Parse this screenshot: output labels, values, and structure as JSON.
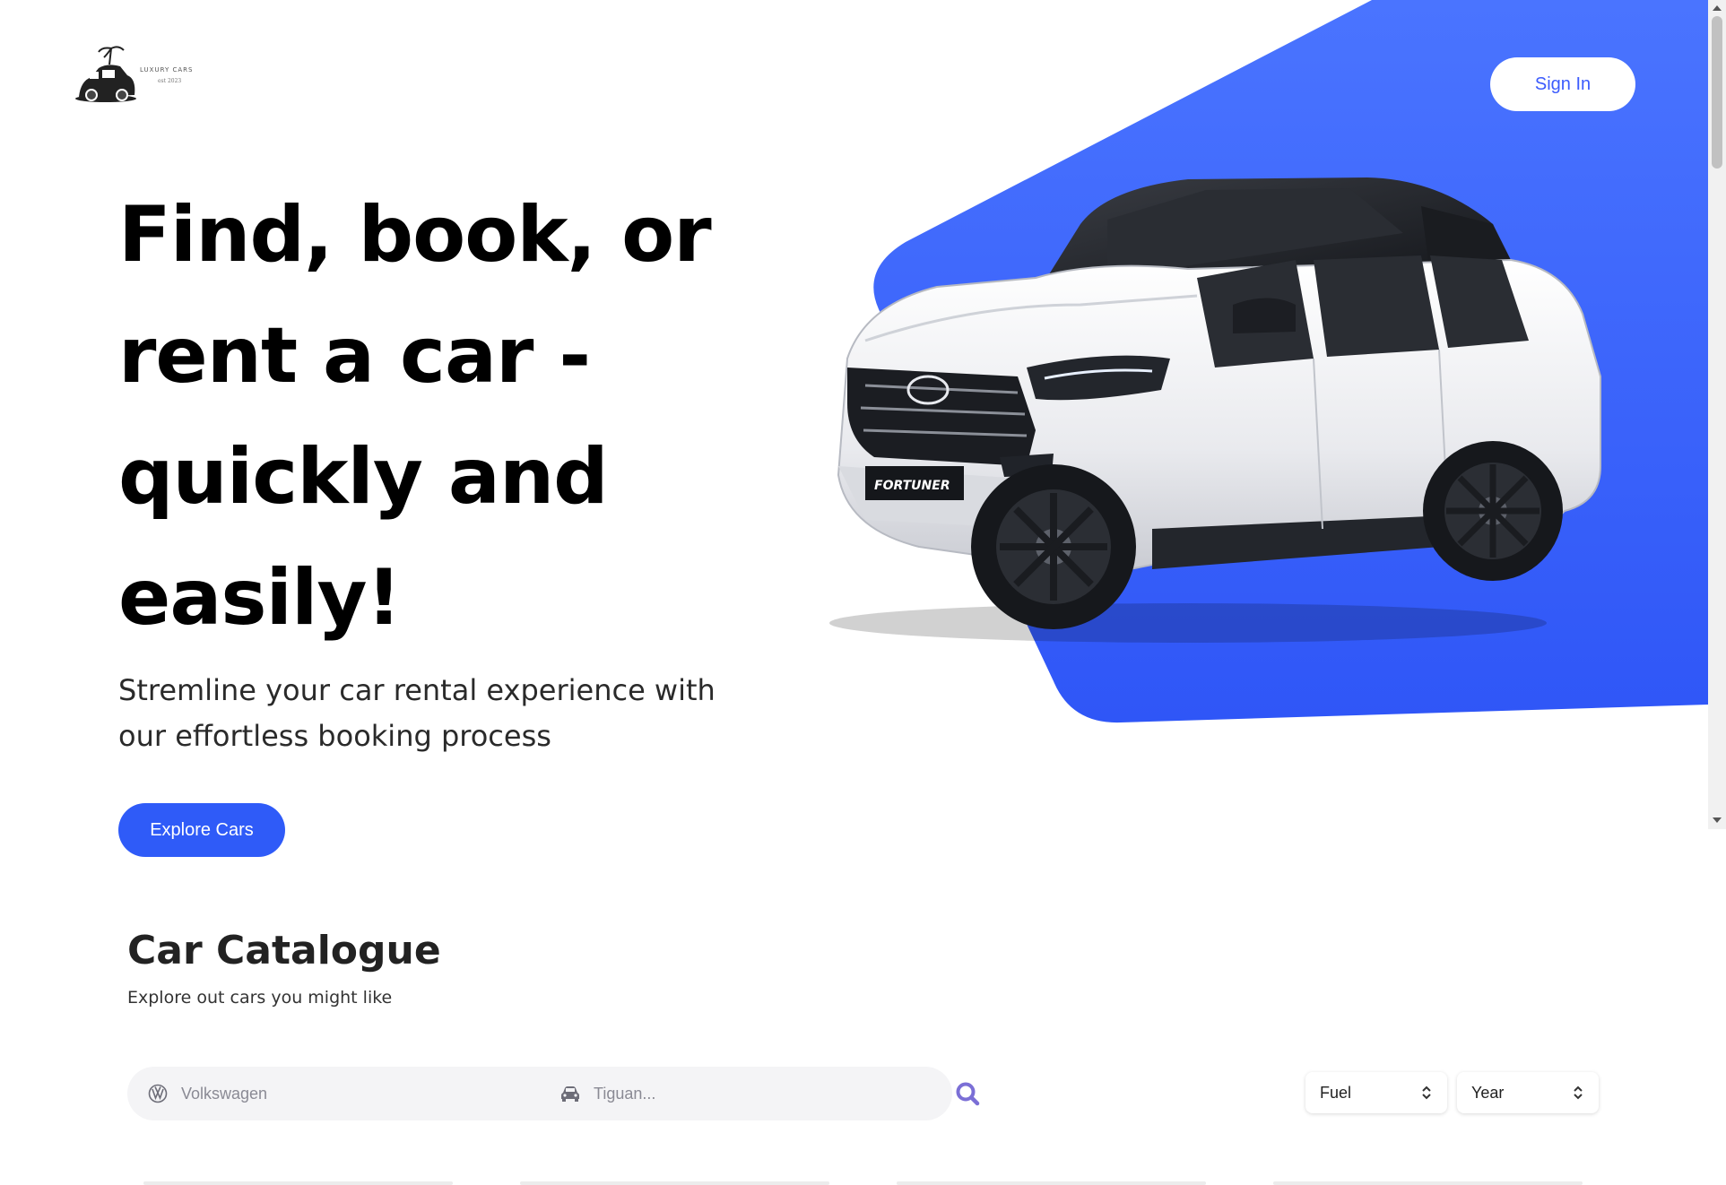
{
  "header": {
    "logo_alt": "Car rental logo",
    "sign_in_label": "Sign In"
  },
  "hero": {
    "headline_line1": "Find, book, or",
    "headline_line2": "rent a car -",
    "headline_line3": "quickly and",
    "headline_line4": "easily!",
    "subtitle_line1": "Stremline your car rental experience with",
    "subtitle_line2": "our effortless booking process",
    "cta_label": "Explore Cars",
    "car_badge": "FORTUNER"
  },
  "catalogue": {
    "title": "Car Catalogue",
    "subtitle": "Explore out cars you might like",
    "search": {
      "make_placeholder": "Volkswagen",
      "model_placeholder": "Tiguan..."
    },
    "filters": {
      "fuel_label": "Fuel",
      "year_label": "Year"
    }
  },
  "colors": {
    "accent": "#2f5bf8",
    "hero_blue": "#3a62fb",
    "text": "#000000"
  },
  "icons": {
    "make": "volkswagen-logo-icon",
    "model": "car-icon",
    "search": "magnifier-icon",
    "select": "chevron-up-down-icon"
  }
}
